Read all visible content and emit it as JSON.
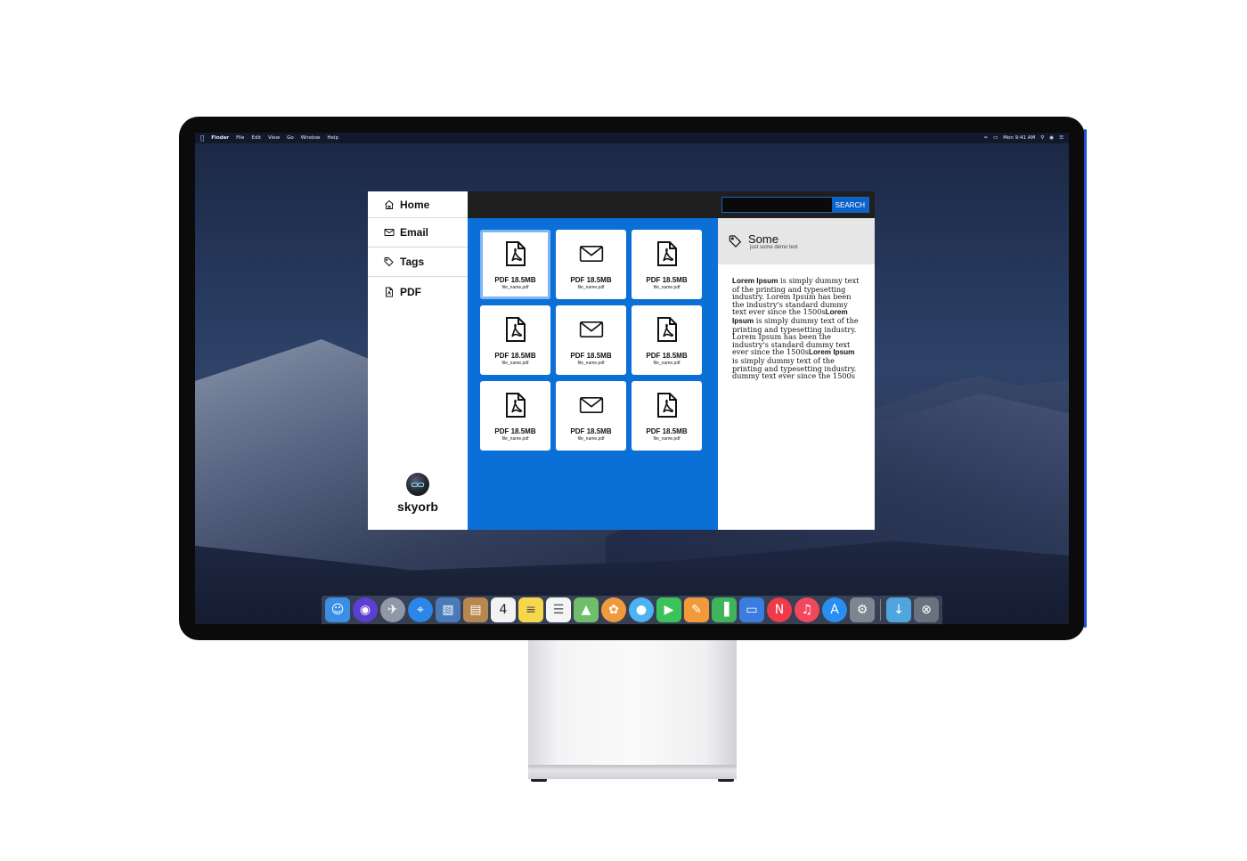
{
  "menubar": {
    "apple": "",
    "items": [
      "Finder",
      "File",
      "Edit",
      "View",
      "Go",
      "Window",
      "Help"
    ],
    "clock": "Mon 9:41 AM"
  },
  "sidebar": {
    "items": [
      {
        "label": "Home",
        "icon": "home-icon"
      },
      {
        "label": "Email",
        "icon": "envelope-icon"
      },
      {
        "label": "Tags",
        "icon": "tag-icon"
      },
      {
        "label": "PDF",
        "icon": "pdf-file-icon"
      }
    ],
    "brand": "skyorb"
  },
  "search": {
    "value": "",
    "placeholder": "",
    "button_label": "SEARCH"
  },
  "files": [
    {
      "type": "pdf",
      "size": "PDF 18.5MB",
      "name": "file_name.pdf",
      "selected": true
    },
    {
      "type": "email",
      "size": "PDF 18.5MB",
      "name": "file_name.pdf"
    },
    {
      "type": "pdf",
      "size": "PDF 18.5MB",
      "name": "file_name.pdf"
    },
    {
      "type": "pdf",
      "size": "PDF 18.5MB",
      "name": "file_name.pdf"
    },
    {
      "type": "email",
      "size": "PDF 18.5MB",
      "name": "file_name.pdf"
    },
    {
      "type": "pdf",
      "size": "PDF 18.5MB",
      "name": "file_name.pdf"
    },
    {
      "type": "pdf",
      "size": "PDF 18.5MB",
      "name": "file_name.pdf"
    },
    {
      "type": "email",
      "size": "PDF 18.5MB",
      "name": "file_name.pdf"
    },
    {
      "type": "pdf",
      "size": "PDF 18.5MB",
      "name": "file_name.pdf"
    }
  ],
  "detail": {
    "title": "Some",
    "subtitle": "just some demo text",
    "body": [
      {
        "bold": "Lorem Ipsum",
        "text": " is simply dummy text of the printing and typesetting industry. Lorem Ipsum has been the industry's standard dummy text ever since the 1500s"
      },
      {
        "bold": "Lorem Ipsum",
        "text": " is simply dummy text of the printing and typesetting industry. Lorem Ipsum has been the industry's standard dummy text ever since the 1500s"
      },
      {
        "bold": "Lorem Ipsum",
        "text": " is simply dummy text of the printing and typesetting industry. dummy text ever since the 1500s"
      }
    ]
  },
  "dock": {
    "apps": [
      {
        "name": "finder-icon",
        "color": "#3a8ee6"
      },
      {
        "name": "siri-icon",
        "color": "#5b3fd0"
      },
      {
        "name": "launchpad-icon",
        "color": "#8e98a8"
      },
      {
        "name": "safari-icon",
        "color": "#2a86e8"
      },
      {
        "name": "preview-icon",
        "color": "#4a7bb8"
      },
      {
        "name": "contacts-icon",
        "color": "#b8874e"
      },
      {
        "name": "calendar-icon",
        "color": "#f2f2f2",
        "label": "4"
      },
      {
        "name": "notes-icon",
        "color": "#f6d64a"
      },
      {
        "name": "reminders-icon",
        "color": "#f4f4f4"
      },
      {
        "name": "maps-icon",
        "color": "#6fbf6a"
      },
      {
        "name": "photos-icon",
        "color": "#f09a3e"
      },
      {
        "name": "messages-icon",
        "color": "#4cb2f2"
      },
      {
        "name": "facetime-icon",
        "color": "#3cc25a"
      },
      {
        "name": "pages-icon",
        "color": "#f29a3a"
      },
      {
        "name": "numbers-icon",
        "color": "#3fb45a"
      },
      {
        "name": "keynote-icon",
        "color": "#3a7de0"
      },
      {
        "name": "news-icon",
        "color": "#f03a4a"
      },
      {
        "name": "music-icon",
        "color": "#f2485e"
      },
      {
        "name": "app-store-icon",
        "color": "#2a8ef0"
      },
      {
        "name": "system-preferences-icon",
        "color": "#7d8590"
      }
    ],
    "extras": [
      {
        "name": "downloads-folder-icon",
        "color": "#4fa6de"
      },
      {
        "name": "trash-icon",
        "color": "#6a7280"
      }
    ]
  }
}
